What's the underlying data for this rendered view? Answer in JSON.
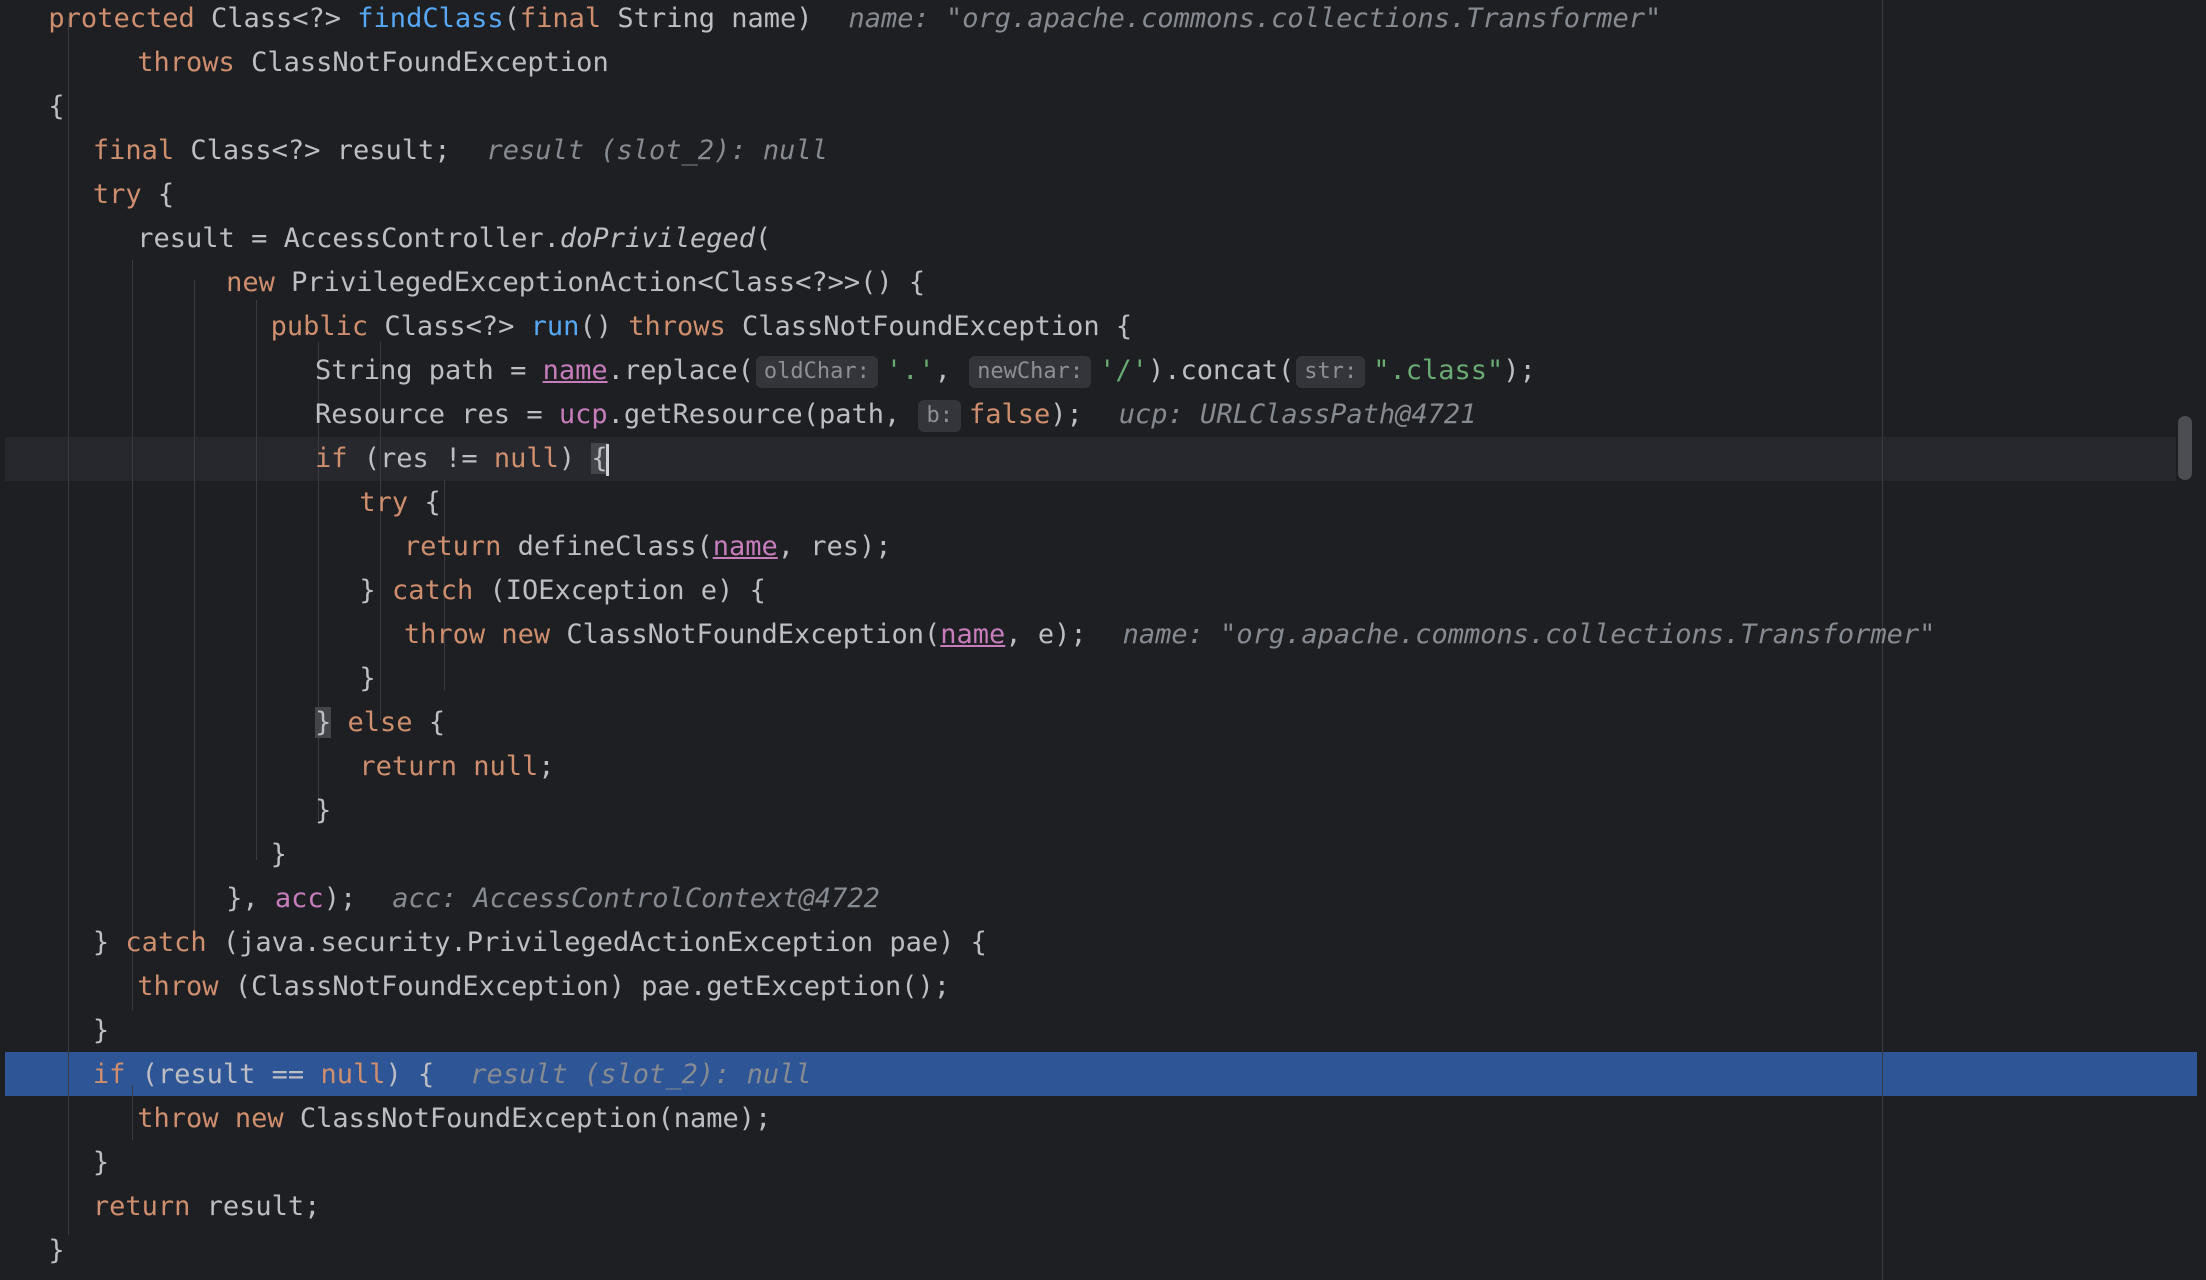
{
  "editor": {
    "lines": [
      {
        "indent": 2,
        "tokens": [
          {
            "t": "protected ",
            "c": "kw"
          },
          {
            "t": "Class<?> "
          },
          {
            "t": "findClass",
            "c": "fn"
          },
          {
            "t": "("
          },
          {
            "t": "final ",
            "c": "kw"
          },
          {
            "t": "String name)"
          },
          {
            "t": "name: \"org.apache.commons.collections.Transformer\"",
            "c": "hint"
          }
        ]
      },
      {
        "indent": 6,
        "tokens": [
          {
            "t": "throws ",
            "c": "kw"
          },
          {
            "t": "ClassNotFoundException"
          }
        ]
      },
      {
        "indent": 2,
        "tokens": [
          {
            "t": "{"
          }
        ]
      },
      {
        "indent": 4,
        "tokens": [
          {
            "t": "final ",
            "c": "kw"
          },
          {
            "t": "Class<?> result;"
          },
          {
            "t": "result (slot_2): null",
            "c": "hint"
          }
        ]
      },
      {
        "indent": 4,
        "tokens": [
          {
            "t": "try ",
            "c": "kw"
          },
          {
            "t": "{"
          }
        ]
      },
      {
        "indent": 6,
        "tokens": [
          {
            "t": "result = AccessController."
          },
          {
            "t": "doPrivileged",
            "c": "it"
          },
          {
            "t": "("
          }
        ]
      },
      {
        "indent": 10,
        "tokens": [
          {
            "t": "new ",
            "c": "kw"
          },
          {
            "t": "PrivilegedExceptionAction<Class<?>>() {"
          }
        ]
      },
      {
        "indent": 12,
        "tokens": [
          {
            "t": "public ",
            "c": "kw"
          },
          {
            "t": "Class<?> "
          },
          {
            "t": "run",
            "c": "fn"
          },
          {
            "t": "() "
          },
          {
            "t": "throws ",
            "c": "kw"
          },
          {
            "t": "ClassNotFoundException {"
          }
        ]
      },
      {
        "indent": 14,
        "tokens": [
          {
            "t": "String path = "
          },
          {
            "t": "name",
            "c": "field-u"
          },
          {
            "t": ".replace("
          },
          {
            "t": "oldChar:",
            "c": "param"
          },
          {
            "t": "'.'",
            "c": "str"
          },
          {
            "t": ", "
          },
          {
            "t": "newChar:",
            "c": "param"
          },
          {
            "t": "'/'",
            "c": "str"
          },
          {
            "t": ").concat("
          },
          {
            "t": "str:",
            "c": "param"
          },
          {
            "t": "\".class\"",
            "c": "str"
          },
          {
            "t": ");"
          }
        ]
      },
      {
        "indent": 14,
        "tokens": [
          {
            "t": "Resource res = "
          },
          {
            "t": "ucp",
            "c": "field"
          },
          {
            "t": ".getResource(path, "
          },
          {
            "t": "b:",
            "c": "param"
          },
          {
            "t": "false",
            "c": "kw"
          },
          {
            "t": ");"
          },
          {
            "t": "ucp: URLClassPath@4721",
            "c": "hint"
          }
        ]
      },
      {
        "indent": 14,
        "tokens": [
          {
            "t": "if ",
            "c": "kw"
          },
          {
            "t": "(res != "
          },
          {
            "t": "null",
            "c": "kw"
          },
          {
            "t": ") "
          },
          {
            "t": "{",
            "c": "brace"
          },
          {
            "t": "",
            "c": "caret"
          }
        ]
      },
      {
        "indent": 16,
        "tokens": [
          {
            "t": "try ",
            "c": "kw"
          },
          {
            "t": "{"
          }
        ]
      },
      {
        "indent": 18,
        "tokens": [
          {
            "t": "return ",
            "c": "kw"
          },
          {
            "t": "defineClass("
          },
          {
            "t": "name",
            "c": "field-u"
          },
          {
            "t": ", res);"
          }
        ]
      },
      {
        "indent": 16,
        "tokens": [
          {
            "t": "} "
          },
          {
            "t": "catch ",
            "c": "kw"
          },
          {
            "t": "(IOException e) {"
          }
        ]
      },
      {
        "indent": 18,
        "tokens": [
          {
            "t": "throw new ",
            "c": "kw"
          },
          {
            "t": "ClassNotFoundException("
          },
          {
            "t": "name",
            "c": "field-u"
          },
          {
            "t": ", e);"
          },
          {
            "t": "name: \"org.apache.commons.collections.Transformer\"",
            "c": "hint"
          }
        ]
      },
      {
        "indent": 16,
        "tokens": [
          {
            "t": "}"
          }
        ]
      },
      {
        "indent": 14,
        "tokens": [
          {
            "t": "}",
            "c": "brace"
          },
          {
            "t": " "
          },
          {
            "t": "else ",
            "c": "kw"
          },
          {
            "t": "{"
          }
        ]
      },
      {
        "indent": 16,
        "tokens": [
          {
            "t": "return null",
            "c": "kw"
          },
          {
            "t": ";"
          }
        ]
      },
      {
        "indent": 14,
        "tokens": [
          {
            "t": "}"
          }
        ]
      },
      {
        "indent": 12,
        "tokens": [
          {
            "t": "}"
          }
        ]
      },
      {
        "indent": 10,
        "tokens": [
          {
            "t": "}, "
          },
          {
            "t": "acc",
            "c": "field"
          },
          {
            "t": ");"
          },
          {
            "t": "acc: AccessControlContext@4722",
            "c": "hint"
          }
        ]
      },
      {
        "indent": 4,
        "tokens": [
          {
            "t": "} "
          },
          {
            "t": "catch ",
            "c": "kw"
          },
          {
            "t": "(java.security.PrivilegedActionException pae) {"
          }
        ]
      },
      {
        "indent": 6,
        "tokens": [
          {
            "t": "throw ",
            "c": "kw"
          },
          {
            "t": "(ClassNotFoundException) pae.getException();"
          }
        ]
      },
      {
        "indent": 4,
        "tokens": [
          {
            "t": "}"
          }
        ]
      },
      {
        "indent": 4,
        "tokens": [
          {
            "t": "if ",
            "c": "kw"
          },
          {
            "t": "(result == "
          },
          {
            "t": "null",
            "c": "kw"
          },
          {
            "t": ") {"
          },
          {
            "t": "result (slot_2): null",
            "c": "hint"
          }
        ]
      },
      {
        "indent": 6,
        "tokens": [
          {
            "t": "throw new ",
            "c": "kw"
          },
          {
            "t": "ClassNotFoundException(name);"
          }
        ]
      },
      {
        "indent": 4,
        "tokens": [
          {
            "t": "}"
          }
        ]
      },
      {
        "indent": 4,
        "tokens": [
          {
            "t": "return ",
            "c": "kw"
          },
          {
            "t": "result;"
          }
        ]
      },
      {
        "indent": 2,
        "tokens": [
          {
            "t": "}"
          }
        ]
      }
    ],
    "current_line": 11,
    "execution_line": 25
  },
  "colors": {
    "background": "#1e1f22",
    "text": "#bcbec4",
    "keyword": "#cf8e6d",
    "method": "#56a8f5",
    "string": "#6aab73",
    "field": "#c77dbb",
    "hint": "#868a91",
    "execution_highlight": "#2e5596"
  }
}
